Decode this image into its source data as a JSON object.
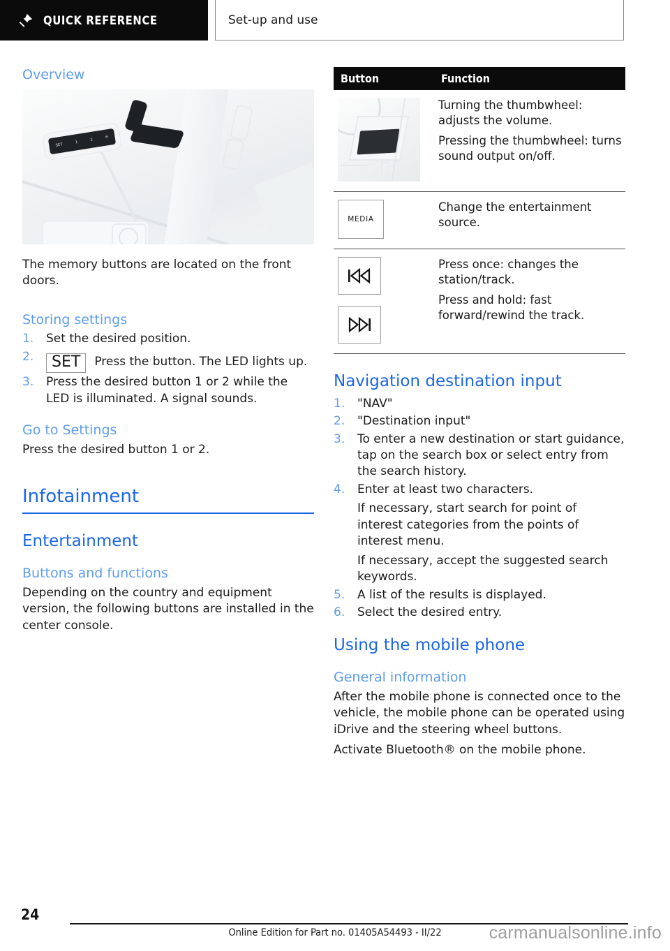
{
  "header": {
    "tab_label": "QUICK REFERENCE",
    "pin_icon": "pushpin-icon",
    "title": "Set-up and use"
  },
  "left_column": {
    "overview_heading": "Overview",
    "door_photo_alt": "front door panel with memory buttons",
    "door_photo_labels": [
      "SET",
      "1",
      "2",
      "seat"
    ],
    "overview_text": "The memory buttons are located on the front doors.",
    "storing_heading": "Storing settings",
    "storing_steps": [
      {
        "num": "1.",
        "text": "Set the desired position."
      },
      {
        "num": "2.",
        "button": "SET",
        "text": "Press the button. The LED lights up."
      },
      {
        "num": "3.",
        "text": "Press the desired button 1 or 2 while the LED is illuminated. A signal sounds."
      }
    ],
    "goto_heading": "Go to Settings",
    "goto_text": "Press the desired button 1 or 2.",
    "infotainment_heading": "Infotainment",
    "entertainment_heading": "Entertainment",
    "buttons_heading": "Buttons and functions",
    "buttons_text": "Depending on the country and equipment version, the following buttons are installed in the center console."
  },
  "right_column": {
    "table": {
      "headers": [
        "Button",
        "Function"
      ],
      "rows": [
        {
          "button_type": "photo",
          "button_name": "thumbwheel-photo",
          "functions": [
            "Turning the thumbwheel: adjusts the volume.",
            "Pressing the thumbwheel: turns sound output on/off."
          ]
        },
        {
          "button_type": "key",
          "button_label": "MEDIA",
          "button_name": "media-key",
          "functions": [
            "Change the entertainment source."
          ]
        },
        {
          "button_type": "key-pair",
          "button_icons": [
            "previous-track-icon",
            "next-track-icon"
          ],
          "functions": [
            "Press once: changes the station/track.",
            "Press and hold: fast forward/rewind the track."
          ]
        }
      ]
    },
    "nav_heading": "Navigation destination input",
    "nav_steps": [
      {
        "num": "1.",
        "text": "\"NAV\""
      },
      {
        "num": "2.",
        "text": "\"Destination input\""
      },
      {
        "num": "3.",
        "text": "To enter a new destination or start guidance, tap on the search box or select entry from the search history."
      },
      {
        "num": "4.",
        "text": "Enter at least two characters.",
        "extra": [
          "If necessary, start search for point of interest categories from the points of interest menu.",
          "If necessary, accept the suggested search keywords."
        ]
      },
      {
        "num": "5.",
        "text": "A list of the results is displayed."
      },
      {
        "num": "6.",
        "text": "Select the desired entry."
      }
    ],
    "phone_heading": "Using the mobile phone",
    "general_heading": "General information",
    "general_paragraphs": [
      "After the mobile phone is connected once to the vehicle, the mobile phone can be operated using iDrive and the steering wheel buttons.",
      "Activate Bluetooth® on the mobile phone."
    ]
  },
  "footer": {
    "page_number": "24",
    "edition_note": "Online Edition for Part no. 01405A54493 - II/22",
    "watermark": "carmanualsonline.info"
  },
  "colors": {
    "heading_strong": "#1a66e8",
    "heading_light": "#5d9cec",
    "bar_black": "#0b0b0b",
    "text": "#1b1b1b"
  }
}
